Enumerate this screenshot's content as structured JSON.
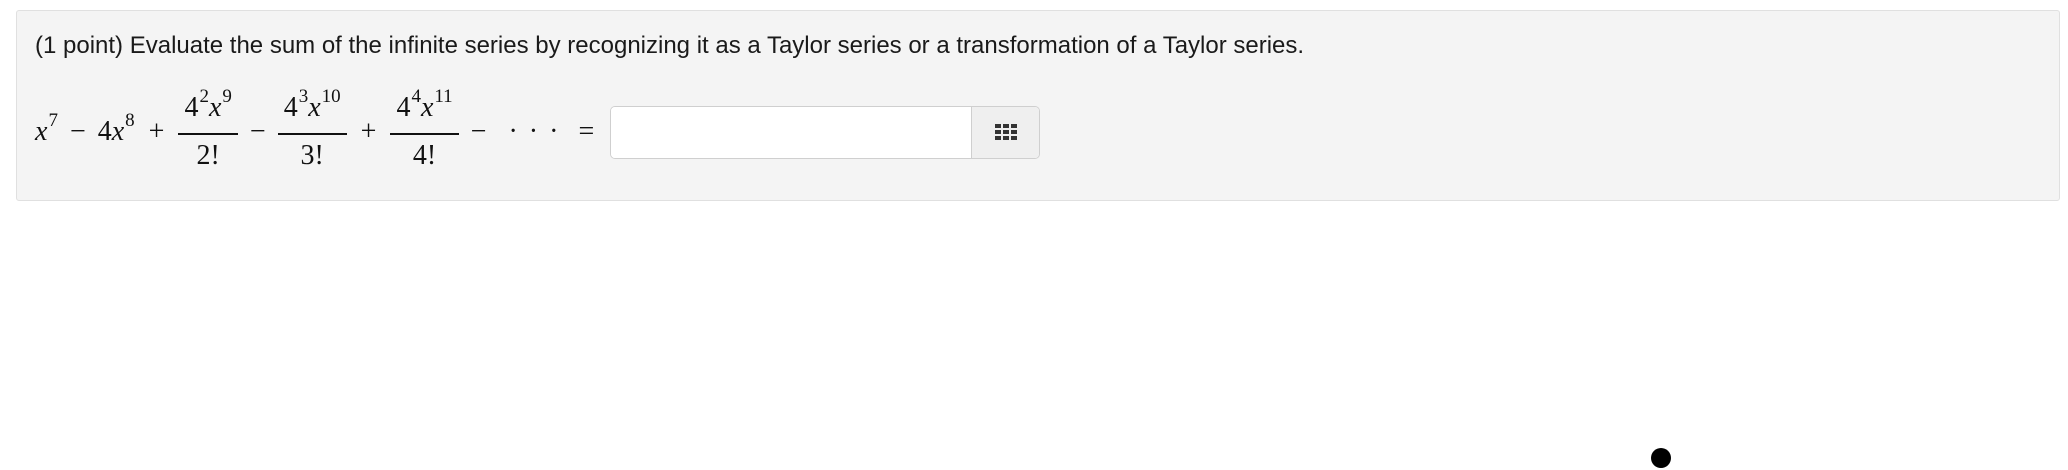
{
  "problem": {
    "points_label": "(1 point)",
    "prompt": "Evaluate the sum of the infinite series by recognizing it as a Taylor series or a transformation of a Taylor series."
  },
  "series": {
    "term1": {
      "var": "x",
      "exp": "7"
    },
    "op1": "−",
    "term2": {
      "coef": "4",
      "var": "x",
      "exp": "8"
    },
    "op2": "+",
    "term3": {
      "base": "4",
      "base_exp": "2",
      "var": "x",
      "var_exp": "9",
      "den": "2!"
    },
    "op3": "−",
    "term4": {
      "base": "4",
      "base_exp": "3",
      "var": "x",
      "var_exp": "10",
      "den": "3!"
    },
    "op4": "+",
    "term5": {
      "base": "4",
      "base_exp": "4",
      "var": "x",
      "var_exp": "11",
      "den": "4!"
    },
    "op5": "−",
    "ellipsis": "· · ·",
    "equals": "="
  },
  "answer": {
    "value": "",
    "placeholder": ""
  },
  "icons": {
    "palette": "grid-icon",
    "cursor": "cursor-dot"
  },
  "colors": {
    "panel_bg": "#f4f4f4",
    "panel_border": "#e0e0e0",
    "button_bg": "#efefef"
  }
}
